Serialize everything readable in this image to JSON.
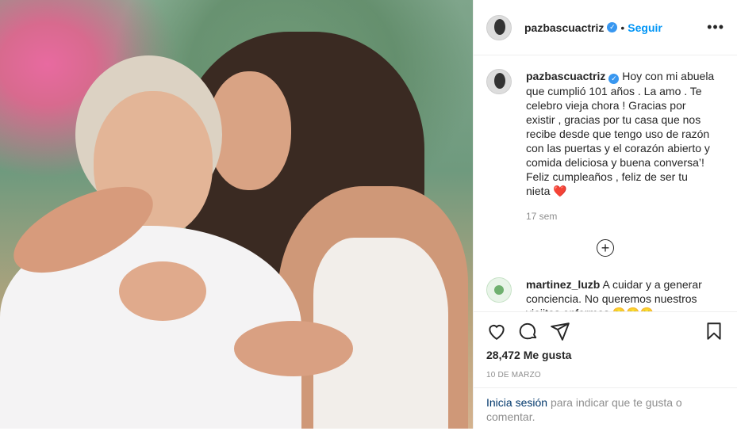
{
  "post": {
    "username": "pazbascuactriz",
    "follow_label": "Seguir",
    "caption_username": "pazbascuactriz",
    "caption": "Hoy con mi abuela que cumplió 101 años . La amo . Te celebro vieja chora ! Gracias por existir , gracias por tu casa que nos recibe desde que tengo uso de razón con las puertas y el corazón abierto y comida deliciosa y buena conversa’! Feliz cumpleaños , feliz de ser tu nieta",
    "caption_emoji": "❤️",
    "caption_time": "17 sem",
    "likes": "28,472 Me gusta",
    "date": "10 DE MARZO"
  },
  "comments": [
    {
      "username": "martinez_luzb",
      "text": "A cuidar y a generar conciencia. No queremos nuestros viejitos enfermos 😄😄😄"
    }
  ],
  "login": {
    "link": "Inicia sesión",
    "text": "para indicar que te gusta o comentar."
  },
  "icons": {
    "verified": "verified-badge",
    "more": "more-options-icon",
    "load_more": "plus-circle-icon",
    "like": "heart-icon",
    "comment": "comment-icon",
    "share": "send-icon",
    "save": "bookmark-icon"
  },
  "colors": {
    "accent": "#0095f6",
    "verified": "#3897f0",
    "link_dark": "#00376b"
  }
}
